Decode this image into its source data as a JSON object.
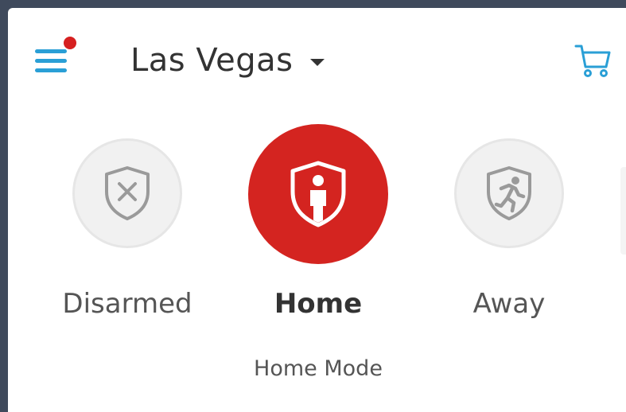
{
  "header": {
    "menu_icon": "hamburger-menu-icon",
    "notification_dot_color": "#d62020",
    "location": "Las Vegas",
    "dropdown_icon": "caret-down-icon",
    "cart_icon": "shopping-cart-icon",
    "accent_color": "#2a9fd6"
  },
  "modes": [
    {
      "label": "Disarmed",
      "icon": "shield-x-icon",
      "active": false
    },
    {
      "label": "Home",
      "icon": "shield-person-icon",
      "active": true
    },
    {
      "label": "Away",
      "icon": "shield-running-person-icon",
      "active": false
    }
  ],
  "status": {
    "text": "Home Mode"
  },
  "colors": {
    "active_mode": "#d42420",
    "inactive_mode": "#f1f1f1",
    "inactive_icon": "#9a9a9a"
  }
}
